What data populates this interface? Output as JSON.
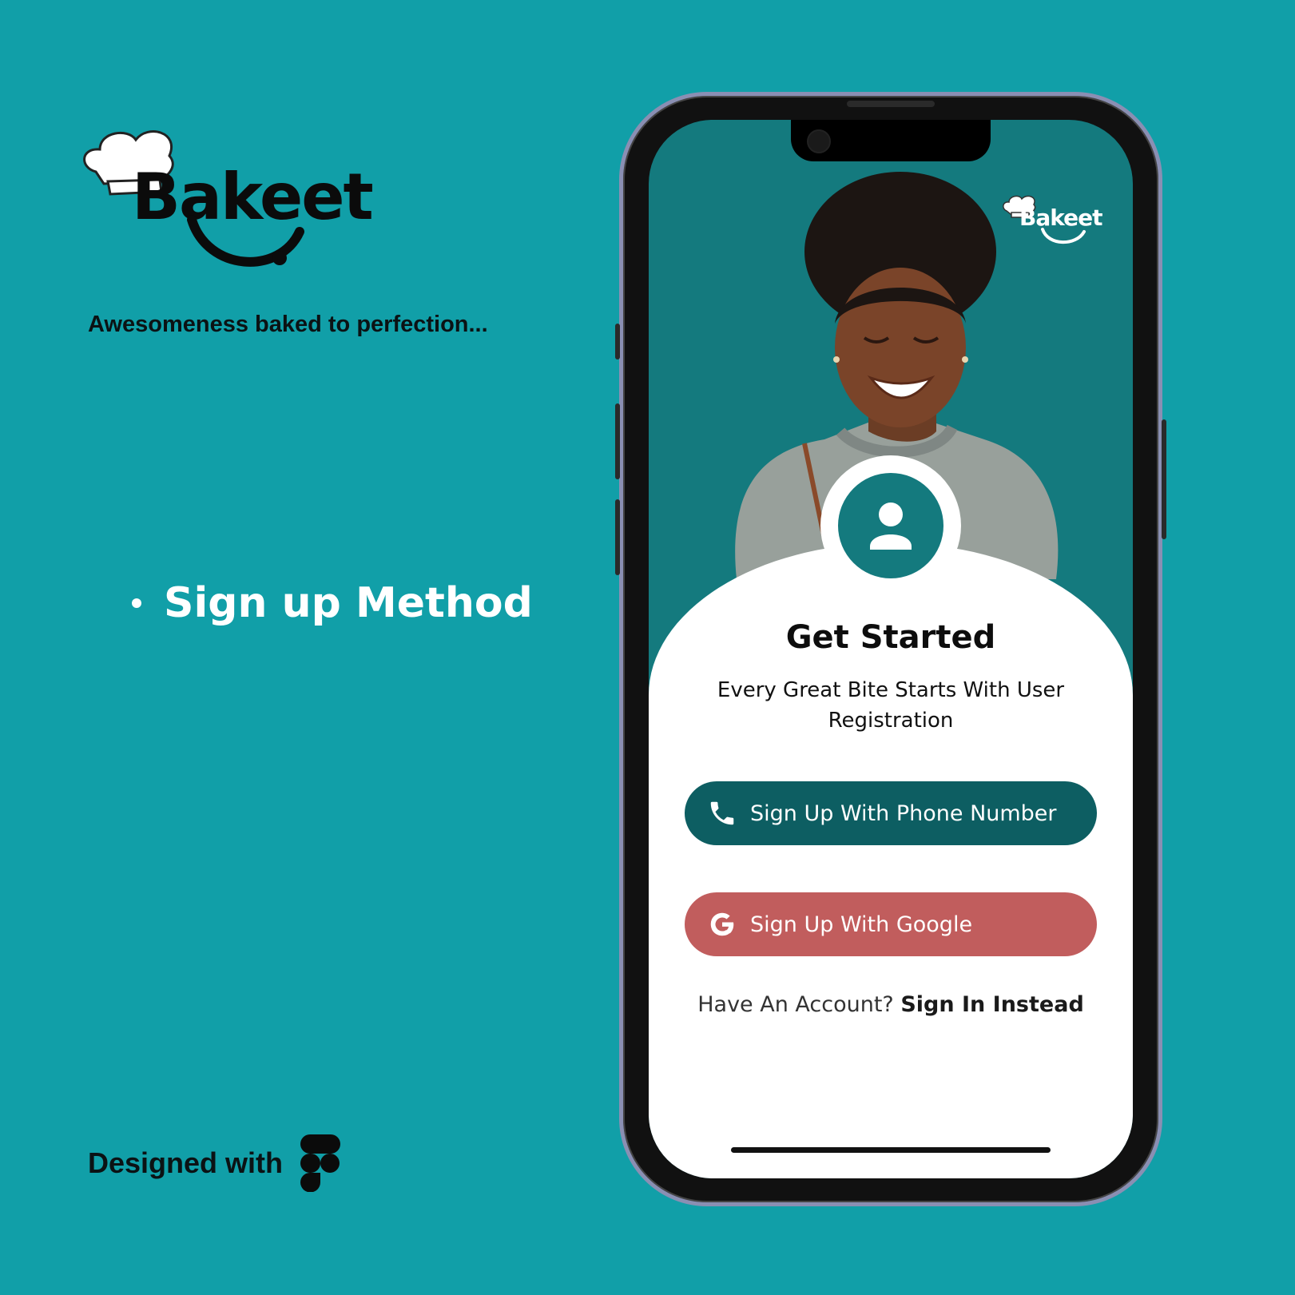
{
  "brand": {
    "name": "Bakeet",
    "tagline": "Awesomeness baked to perfection..."
  },
  "section": {
    "label": "Sign up Method"
  },
  "footer": {
    "designed_with": "Designed with",
    "tool_icon": "figma-icon"
  },
  "phone": {
    "app_logo": "Bakeet",
    "icons": {
      "avatar": "user-icon",
      "phone": "phone-icon",
      "google": "google-icon"
    },
    "title": "Get Started",
    "subtitle": "Every Great Bite Starts With User Registration",
    "buttons": {
      "phone_label": "Sign Up With Phone Number",
      "google_label": "Sign Up With Google"
    },
    "signin": {
      "prompt": "Have An Account?",
      "link": "Sign In Instead"
    }
  },
  "colors": {
    "background": "#119fa8",
    "primary": "#147a7e",
    "phone_button": "#0d5e62",
    "google_button": "#c15d5d"
  }
}
